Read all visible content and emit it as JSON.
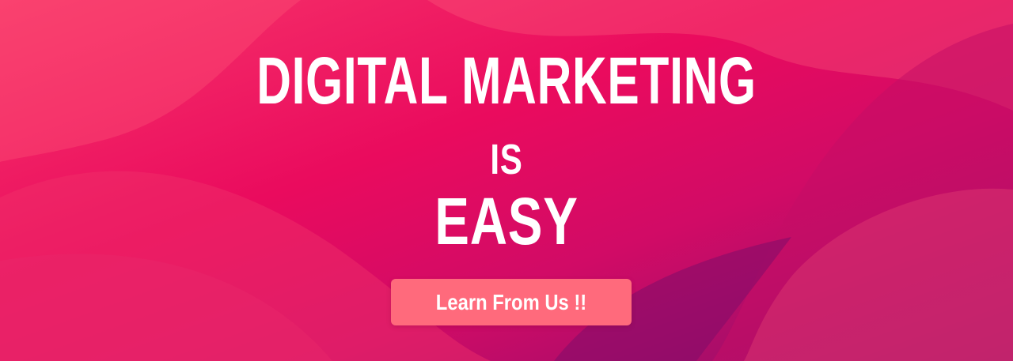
{
  "banner": {
    "headline_line1": "DIGITAL MARKETING",
    "headline_line2": "IS",
    "headline_line3": "EASY",
    "cta_label": "Learn From Us !!"
  },
  "colors": {
    "background_top": "#f7366a",
    "background_mid": "#ea0b5e",
    "background_bottom": "#8a0f6c",
    "text": "#ffffff",
    "cta_background": "#ff6a7c"
  }
}
